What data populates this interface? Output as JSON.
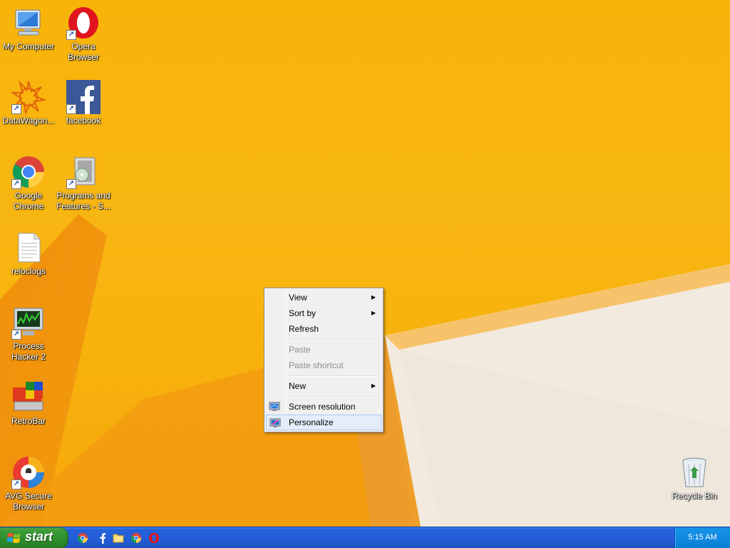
{
  "desktop": {
    "icons": [
      {
        "label": "My Computer",
        "icon": "my-computer-icon"
      },
      {
        "label": "Opera Browser",
        "icon": "opera-icon"
      },
      {
        "label": "DataWagon...",
        "icon": "datawagon-icon"
      },
      {
        "label": "facebook",
        "icon": "facebook-icon"
      },
      {
        "label": "Google Chrome",
        "icon": "chrome-icon"
      },
      {
        "label": "Programs and Features - S...",
        "icon": "programs-features-icon"
      },
      {
        "label": "reloclogs",
        "icon": "text-file-icon"
      },
      {
        "label": "Process Hacker 2",
        "icon": "process-hacker-icon"
      },
      {
        "label": "RetroBar",
        "icon": "retrobar-icon"
      },
      {
        "label": "AVG Secure Browser",
        "icon": "avg-browser-icon"
      },
      {
        "label": "Recycle Bin",
        "icon": "recycle-bin-icon"
      }
    ]
  },
  "context_menu": {
    "items": [
      {
        "label": "View",
        "submenu": true,
        "enabled": true
      },
      {
        "label": "Sort by",
        "submenu": true,
        "enabled": true
      },
      {
        "label": "Refresh",
        "submenu": false,
        "enabled": true
      },
      {
        "label": "Paste",
        "submenu": false,
        "enabled": false
      },
      {
        "label": "Paste shortcut",
        "submenu": false,
        "enabled": false
      },
      {
        "label": "New",
        "submenu": true,
        "enabled": true
      },
      {
        "label": "Screen resolution",
        "submenu": false,
        "enabled": true,
        "icon": "screen-resolution-icon"
      },
      {
        "label": "Personalize",
        "submenu": false,
        "enabled": true,
        "icon": "personalize-icon",
        "highlighted": true
      }
    ]
  },
  "taskbar": {
    "start_label": "start",
    "quick_launch": [
      "chrome-icon",
      "facebook-icon",
      "folder-icon",
      "chrome-icon",
      "opera-icon"
    ],
    "clock": "5:15 AM"
  },
  "colors": {
    "wallpaper": "#f8b612",
    "taskbar": "#245edb",
    "start_button": "#2d8c2a",
    "tray": "#0f8ae0"
  }
}
